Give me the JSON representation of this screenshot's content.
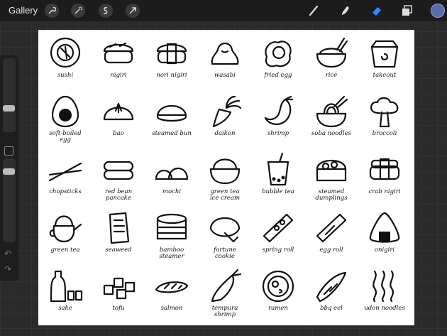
{
  "toolbar": {
    "gallery_label": "Gallery",
    "left_tools": [
      "wrench-icon",
      "magic-wand-icon",
      "selection-icon",
      "transform-arrow-icon"
    ],
    "right_tools": [
      "brush-icon",
      "smudge-icon",
      "eraser-icon",
      "layers-icon"
    ],
    "active_tool": "eraser-icon",
    "active_color": "#5a6bb0",
    "accent": "#2f8cff"
  },
  "sidebar": {
    "controls": [
      "brush-size-slider",
      "modify-button",
      "opacity-slider",
      "undo-icon",
      "redo-icon"
    ]
  },
  "canvas": {
    "items": [
      {
        "label": "sushi",
        "icon": "sushi-roll"
      },
      {
        "label": "nigiri",
        "icon": "nigiri"
      },
      {
        "label": "nori nigiri",
        "icon": "nori-nigiri"
      },
      {
        "label": "wasabi",
        "icon": "wasabi"
      },
      {
        "label": "fried egg",
        "icon": "fried-egg"
      },
      {
        "label": "rice",
        "icon": "rice-bowl"
      },
      {
        "label": "takeout",
        "icon": "takeout-box"
      },
      {
        "label": "soft-boiled\negg",
        "icon": "soft-boiled-egg"
      },
      {
        "label": "bao",
        "icon": "bao"
      },
      {
        "label": "steamed bun",
        "icon": "steamed-bun"
      },
      {
        "label": "daikon",
        "icon": "daikon"
      },
      {
        "label": "shrimp",
        "icon": "shrimp"
      },
      {
        "label": "soba noodles",
        "icon": "noodle-bowl"
      },
      {
        "label": "broccoli",
        "icon": "broccoli"
      },
      {
        "label": "chopsticks",
        "icon": "chopsticks"
      },
      {
        "label": "red bean\npancake",
        "icon": "pancake"
      },
      {
        "label": "mochi",
        "icon": "mochi"
      },
      {
        "label": "green tea\nice cream",
        "icon": "ice-cream-bowl"
      },
      {
        "label": "bubble tea",
        "icon": "bubble-tea"
      },
      {
        "label": "steamed\ndumplings",
        "icon": "dumpling-basket"
      },
      {
        "label": "crab nigiri",
        "icon": "crab-nigiri"
      },
      {
        "label": "green tea",
        "icon": "teapot"
      },
      {
        "label": "seaweed",
        "icon": "seaweed"
      },
      {
        "label": "bamboo\nsteamer",
        "icon": "bamboo-steamer"
      },
      {
        "label": "fortune\ncookie",
        "icon": "fortune-cookie"
      },
      {
        "label": "spring roll",
        "icon": "spring-roll"
      },
      {
        "label": "egg roll",
        "icon": "egg-roll"
      },
      {
        "label": "onigiri",
        "icon": "onigiri"
      },
      {
        "label": "sake",
        "icon": "sake-bottle"
      },
      {
        "label": "tofu",
        "icon": "tofu"
      },
      {
        "label": "salmon",
        "icon": "salmon"
      },
      {
        "label": "tempura\nshrimp",
        "icon": "tempura"
      },
      {
        "label": "ramen",
        "icon": "ramen-bowl"
      },
      {
        "label": "bbq eel",
        "icon": "bbq-eel"
      },
      {
        "label": "udon noodles",
        "icon": "udon"
      }
    ]
  }
}
